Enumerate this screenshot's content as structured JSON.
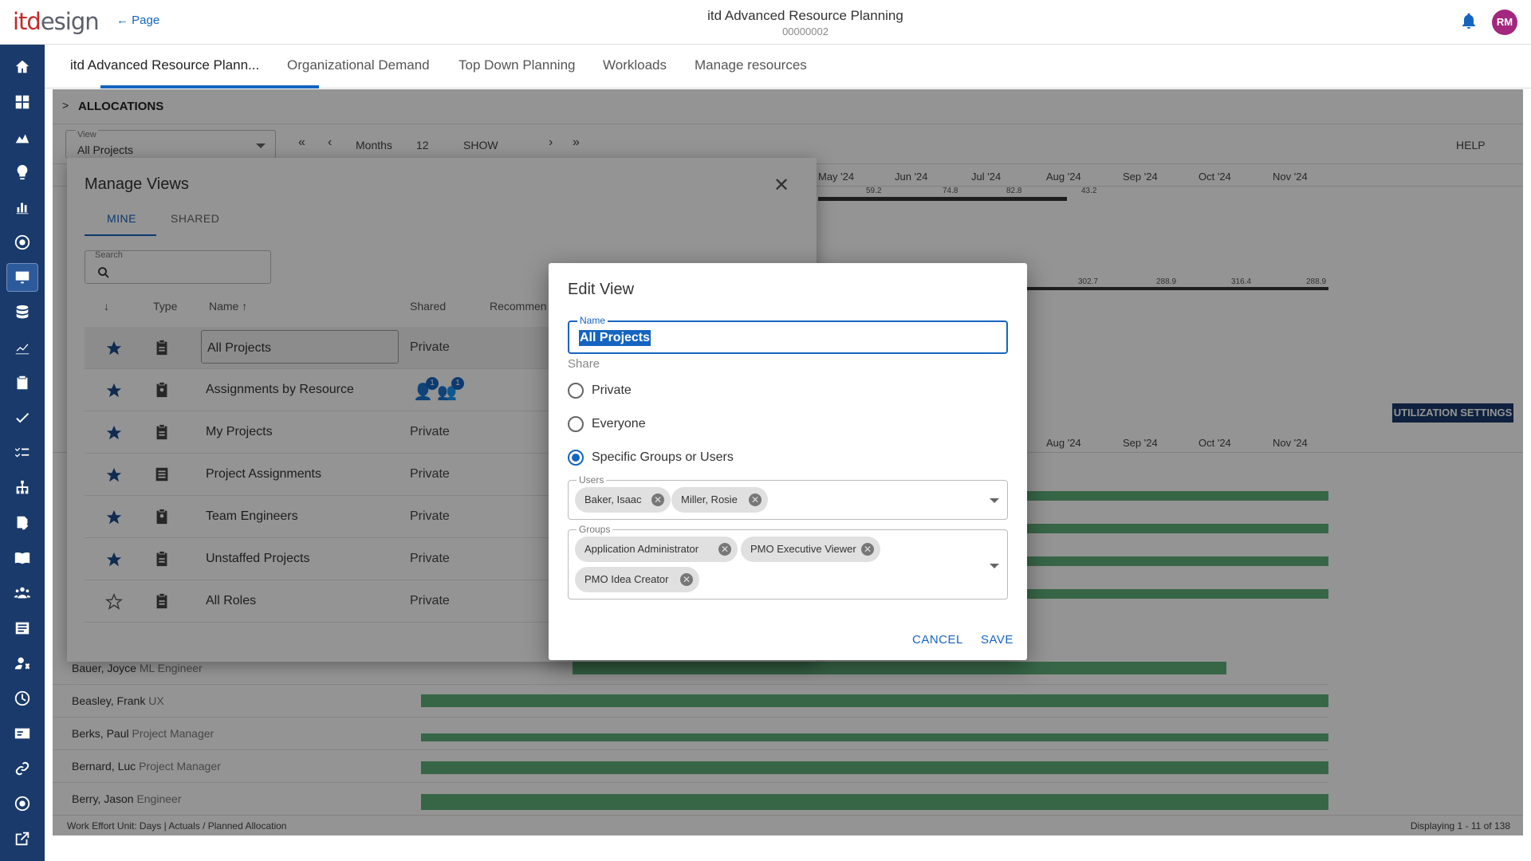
{
  "header": {
    "logo": "itdesign",
    "back_label": "Page",
    "title": "itd Advanced Resource Planning",
    "subtitle": "00000002",
    "avatar": "RM"
  },
  "tabs": [
    {
      "label": "itd Advanced Resource Plann..."
    },
    {
      "label": "Organizational Demand"
    },
    {
      "label": "Top Down Planning"
    },
    {
      "label": "Workloads"
    },
    {
      "label": "Manage resources"
    }
  ],
  "allocations": {
    "title": "ALLOCATIONS",
    "view_label": "View",
    "view_value": "All Projects",
    "period": "Months",
    "count": "12",
    "show": "SHOW",
    "help": "HELP",
    "util_settings": "UTILIZATION SETTINGS",
    "months": [
      "May '24",
      "Jun '24",
      "Jul '24",
      "Aug '24",
      "Sep '24",
      "Oct '24",
      "Nov '24"
    ],
    "months_lower": [
      "Aug '24",
      "Sep '24",
      "Oct '24",
      "Nov '24"
    ],
    "top_values": [
      "59.2",
      "74.8",
      "82.8",
      "43.2"
    ],
    "total_values": [
      "302.7",
      "288.9",
      "316.4",
      "288.9"
    ],
    "rows": [
      {
        "name": "Bauer, Joyce",
        "role": "ML Engineer"
      },
      {
        "name": "Beasley, Frank",
        "role": "UX"
      },
      {
        "name": "Berks, Paul",
        "role": "Project Manager"
      },
      {
        "name": "Bernard, Luc",
        "role": "Project Manager"
      },
      {
        "name": "Berry, Jason",
        "role": "Engineer"
      }
    ],
    "footer_left": "Work Effort Unit: Days | Actuals / Planned Allocation",
    "footer_right": "Displaying 1 - 11 of 138"
  },
  "manage_views": {
    "title": "Manage Views",
    "tab_mine": "MINE",
    "tab_shared": "SHARED",
    "search_label": "Search",
    "col_type": "Type",
    "col_name": "Name",
    "col_shared": "Shared",
    "col_recommend": "Recommen",
    "rows": [
      {
        "name": "All Projects",
        "shared": "Private"
      },
      {
        "name": "Assignments by Resource",
        "shared": ""
      },
      {
        "name": "My Projects",
        "shared": "Private"
      },
      {
        "name": "Project Assignments",
        "shared": "Private"
      },
      {
        "name": "Team Engineers",
        "shared": "Private"
      },
      {
        "name": "Unstaffed Projects",
        "shared": "Private"
      },
      {
        "name": "All Roles",
        "shared": "Private"
      }
    ],
    "badge_count": "1"
  },
  "edit_view": {
    "title": "Edit View",
    "name_label": "Name",
    "name_value": "All Projects",
    "share_label": "Share",
    "opt_private": "Private",
    "opt_everyone": "Everyone",
    "opt_specific": "Specific Groups or Users",
    "users_label": "Users",
    "users": [
      "Baker, Isaac",
      "Miller, Rosie"
    ],
    "groups_label": "Groups",
    "groups": [
      "Application Administrator",
      "PMO Executive Viewer",
      "PMO Idea Creator"
    ],
    "cancel": "CANCEL",
    "save": "SAVE"
  },
  "colors": {
    "primary": "#1565c0",
    "rail": "#1a3a6b",
    "avatar": "#a3267f",
    "bar": "#5fb07a"
  }
}
